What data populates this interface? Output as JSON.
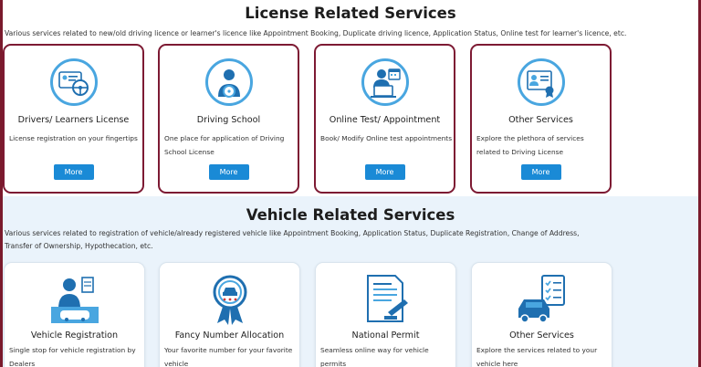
{
  "license_section": {
    "title": "License Related Services",
    "description": "Various services related to new/old driving licence or learner's licence like Appointment Booking, Duplicate driving licence, Application Status, Online test for learner's licence, etc.",
    "cards": [
      {
        "title": "Drivers/ Learners License",
        "description": "License registration on your fingertips",
        "button": "More",
        "icon": "license-card-steering-icon"
      },
      {
        "title": "Driving School",
        "description": "One place for application of Driving School License",
        "button": "More",
        "icon": "driver-steering-icon"
      },
      {
        "title": "Online Test/ Appointment",
        "description": "Book/ Modify Online test appointments",
        "button": "More",
        "icon": "online-test-calendar-icon"
      },
      {
        "title": "Other Services",
        "description": "Explore the plethora of services related to Driving License",
        "button": "More",
        "icon": "certificate-icon"
      }
    ]
  },
  "vehicle_section": {
    "title": "Vehicle Related Services",
    "description": "Various services related to registration of vehicle/already registered vehicle like Appointment Booking, Application Status, Duplicate Registration, Change of Address, Transfer of Ownership, Hypothecation, etc.",
    "cards": [
      {
        "title": "Vehicle Registration",
        "description": "Single stop for vehicle registration by Dealers",
        "icon": "vehicle-registration-icon"
      },
      {
        "title": "Fancy Number Allocation",
        "description": "Your favorite number for your favorite vehicle",
        "icon": "number-badge-icon"
      },
      {
        "title": "National Permit",
        "description": "Seamless online way for vehicle permits",
        "icon": "permit-document-icon"
      },
      {
        "title": "Other Services",
        "description": "Explore the services related to your vehicle here",
        "icon": "vehicle-checklist-icon"
      }
    ]
  },
  "colors": {
    "accent": "#1a8ad6",
    "card_border": "#7d1a33",
    "icon_blue": "#49a6e0",
    "vehicle_bg": "#eaf3fb"
  }
}
